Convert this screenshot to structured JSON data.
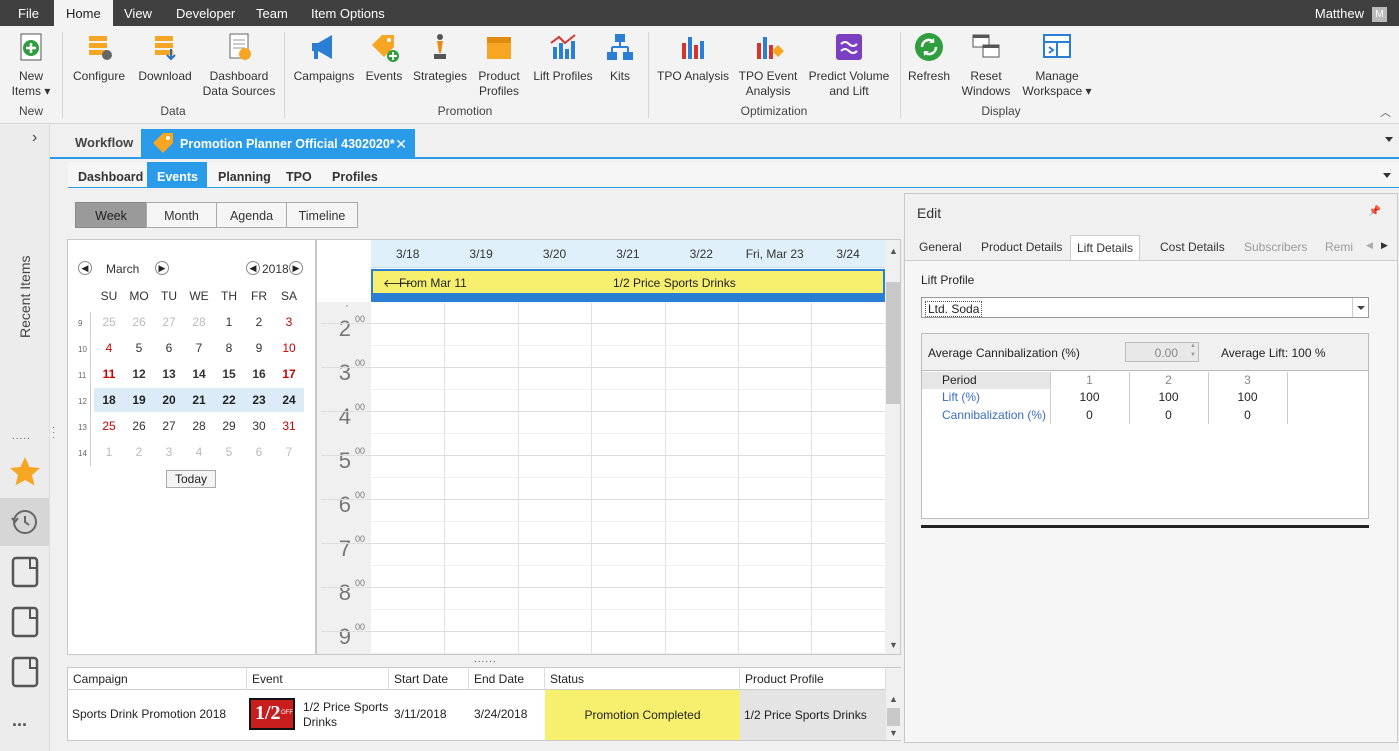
{
  "menu": {
    "items": [
      "File",
      "Home",
      "View",
      "Developer",
      "Team",
      "Item Options"
    ],
    "active": "Home",
    "user": "Matthew",
    "user_initial": "M"
  },
  "ribbon": {
    "new": {
      "label1": "New",
      "label2": "Items ▾",
      "group": "New"
    },
    "data": {
      "group": "Data",
      "configure": "Configure",
      "download": "Download",
      "dashboard1": "Dashboard",
      "dashboard2": "Data Sources"
    },
    "promotion": {
      "group": "Promotion",
      "campaigns": "Campaigns",
      "events": "Events",
      "strategies": "Strategies",
      "product1": "Product",
      "product2": "Profiles",
      "lift": "Lift Profiles",
      "kits": "Kits"
    },
    "optimization": {
      "group": "Optimization",
      "tpo": "TPO Analysis",
      "tpoe1": "TPO Event",
      "tpoe2": "Analysis",
      "pv1": "Predict Volume",
      "pv2": "and Lift"
    },
    "display": {
      "group": "Display",
      "refresh": "Refresh",
      "reset1": "Reset",
      "reset2": "Windows",
      "manage1": "Manage",
      "manage2": "Workspace ▾"
    }
  },
  "sidebar": {
    "recent": "Recent Items",
    "more": "..."
  },
  "workspace": {
    "workflow": "Workflow",
    "doc_tab": "Promotion Planner Official 4302020*"
  },
  "subtabs": [
    "Dashboard",
    "Events",
    "Planning",
    "TPO",
    "Profiles"
  ],
  "views": [
    "Week",
    "Month",
    "Agenda",
    "Timeline"
  ],
  "calendar": {
    "month": "March",
    "year": "2018",
    "today": "Today",
    "dow": [
      "SU",
      "MO",
      "TU",
      "WE",
      "TH",
      "FR",
      "SA"
    ],
    "weeks": [
      {
        "wk": "9",
        "days": [
          "25",
          "26",
          "27",
          "28",
          "1",
          "2",
          "3"
        ]
      },
      {
        "wk": "10",
        "days": [
          "4",
          "5",
          "6",
          "7",
          "8",
          "9",
          "10"
        ]
      },
      {
        "wk": "11",
        "days": [
          "11",
          "12",
          "13",
          "14",
          "15",
          "16",
          "17"
        ]
      },
      {
        "wk": "12",
        "days": [
          "18",
          "19",
          "20",
          "21",
          "22",
          "23",
          "24"
        ]
      },
      {
        "wk": "13",
        "days": [
          "25",
          "26",
          "27",
          "28",
          "29",
          "30",
          "31"
        ]
      },
      {
        "wk": "14",
        "days": [
          "1",
          "2",
          "3",
          "4",
          "5",
          "6",
          "7"
        ]
      }
    ]
  },
  "schedule": {
    "days": [
      "3/18",
      "3/19",
      "3/20",
      "3/21",
      "3/22",
      "Fri, Mar 23",
      "3/24"
    ],
    "event_prefix": "From Mar 11",
    "event_title": "1/2 Price Sports Drinks",
    "hours": [
      "2",
      "3",
      "4",
      "5",
      "6",
      "7",
      "8",
      "9"
    ],
    "minutes": "00"
  },
  "grid": {
    "headers": [
      "Campaign",
      "Event",
      "Start Date",
      "End Date",
      "Status",
      "Product Profile"
    ],
    "row": {
      "campaign": "Sports Drink Promotion 2018",
      "event": "1/2 Price Sports Drinks",
      "start": "3/11/2018",
      "end": "3/24/2018",
      "status": "Promotion Completed",
      "profile": "1/2 Price Sports Drinks",
      "thumb_big": "1/2",
      "thumb_small": "OFF"
    }
  },
  "edit": {
    "title": "Edit",
    "tabs": [
      "General",
      "Product Details",
      "Lift Details",
      "Cost Details",
      "Subscribers",
      "Remi"
    ],
    "lift_profile_label": "Lift Profile",
    "lift_profile_value": "Ltd. Soda",
    "avg_cannib_label": "Average Cannibalization (%)",
    "avg_cannib_value": "0.00",
    "avg_lift": "Average Lift: 100 %",
    "period_label": "Period",
    "lift_label": "Lift (%)",
    "cannib_label": "Cannibalization (%)",
    "periods": [
      "1",
      "2",
      "3"
    ],
    "lift_values": [
      "100",
      "100",
      "100"
    ],
    "cannib_values": [
      "0",
      "0",
      "0"
    ]
  }
}
